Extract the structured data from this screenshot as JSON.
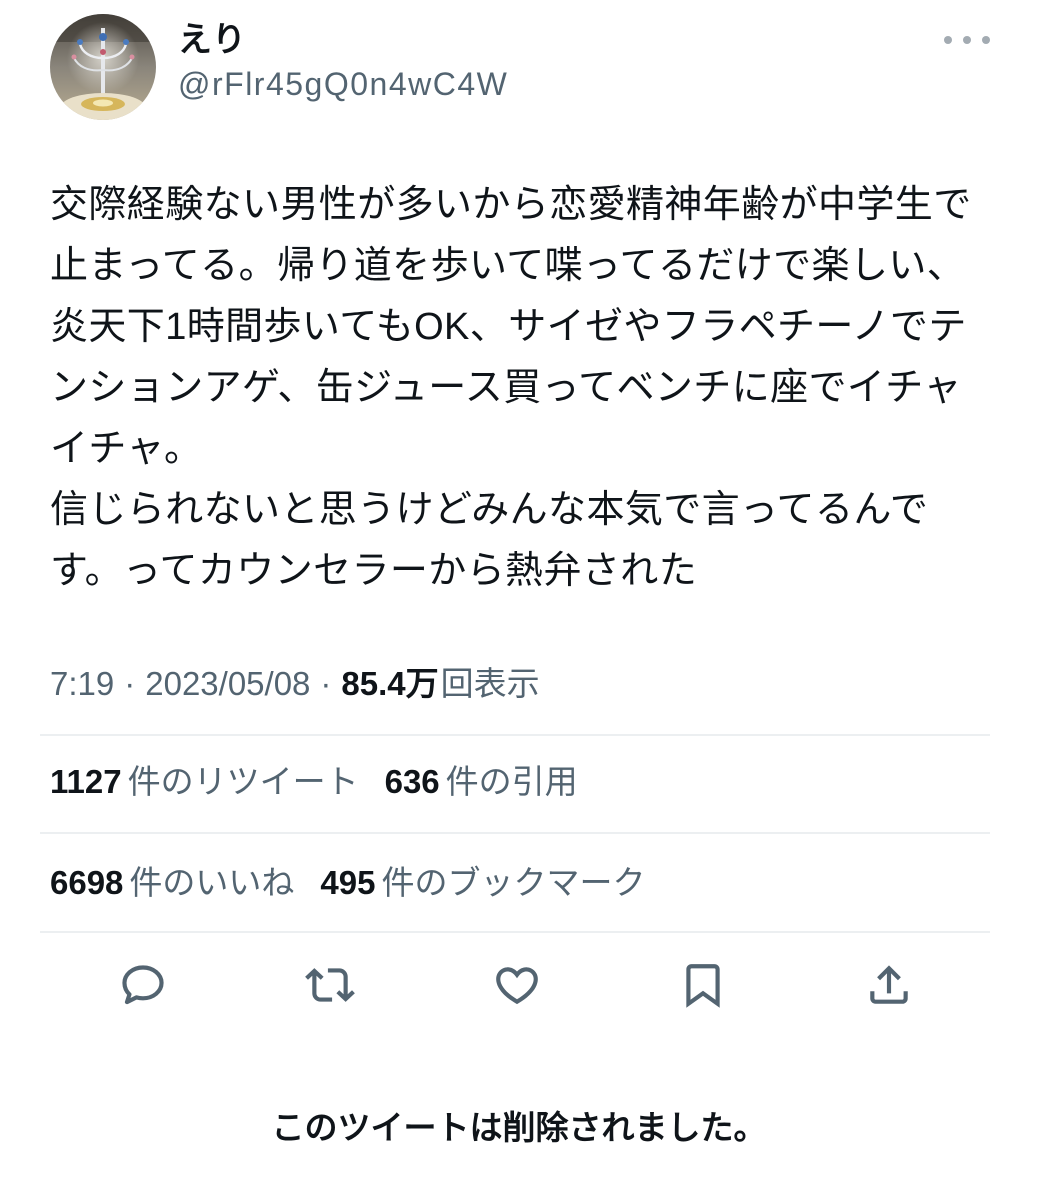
{
  "theme": {
    "background": "#ffffff",
    "text": "#0f1419",
    "secondary": "#536471",
    "divider": "#eceff1",
    "icon": "#536471"
  },
  "tweet": {
    "author": {
      "display_name": "えり",
      "handle": "@rFlr45gQ0n4wC4W"
    },
    "more_icon": "more-horizontal-icon",
    "body_lines": [
      "交際経験ない男性が多いから恋愛精神年齢が中学生で",
      "止まってる。帰り道を歩いて喋ってるだけで楽しい、",
      "炎天下1時間歩いてもOK、サイゼやフラペチーノでテ",
      "ンションアゲ、缶ジュース買ってベンチに座でイチャ",
      "イチャ。",
      "信じられないと思うけどみんな本気で言ってるんで",
      "す。ってカウンセラーから熱弁された"
    ],
    "meta": {
      "time": "7:19",
      "separator": "·",
      "date": "2023/05/08",
      "views_count": "85.4万",
      "views_label": "回表示"
    },
    "stats": {
      "retweets": {
        "count": "1127",
        "label": "件のリツイート"
      },
      "quotes": {
        "count": "636",
        "label": "件の引用"
      },
      "likes": {
        "count": "6698",
        "label": "件のいいね"
      },
      "bookmarks": {
        "count": "495",
        "label": "件のブックマーク"
      }
    },
    "action_icons": [
      "reply-icon",
      "retweet-icon",
      "heart-icon",
      "bookmark-icon",
      "share-icon"
    ]
  },
  "notice": {
    "text": "このツイートは削除されました。"
  }
}
